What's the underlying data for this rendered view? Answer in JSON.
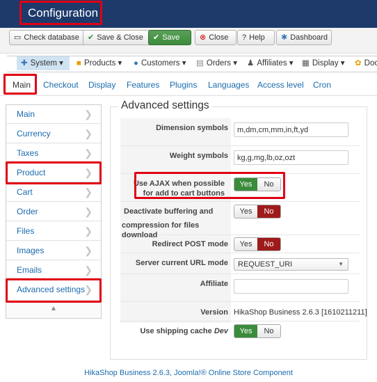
{
  "header": {
    "title": "Configuration"
  },
  "toolbar": {
    "check_database": "Check database",
    "save_close": "Save & Close",
    "save": "Save",
    "close": "Close",
    "help": "Help",
    "dashboard": "Dashboard"
  },
  "menu": {
    "system": "System",
    "products": "Products",
    "customers": "Customers",
    "orders": "Orders",
    "affiliates": "Affiliates",
    "display": "Display",
    "documentation": "Doc"
  },
  "tabs": [
    "Main",
    "Checkout",
    "Display",
    "Features",
    "Plugins",
    "Languages",
    "Access level",
    "Cron"
  ],
  "sidebar": {
    "items": [
      "Main",
      "Currency",
      "Taxes",
      "Product",
      "Cart",
      "Order",
      "Files",
      "Images",
      "Emails",
      "Advanced settings"
    ]
  },
  "section": {
    "title": "Advanced settings"
  },
  "settings": {
    "dimension_label": "Dimension symbols",
    "dimension_value": "m,dm,cm,mm,in,ft,yd",
    "weight_label": "Weight symbols",
    "weight_value": "kg,g,mg,lb,oz,ozt",
    "ajax_label_1": "Use AJAX when possible",
    "ajax_label_2": "for add to cart buttons",
    "buffer_label_1": "Deactivate buffering and",
    "buffer_label_2": "compression for files download",
    "redirect_label": "Redirect POST mode",
    "url_mode_label": "Server current URL mode",
    "url_mode_value": "REQUEST_URI",
    "affiliate_label": "Affiliate",
    "affiliate_value": "",
    "version_label": "Version",
    "version_value": "HikaShop Business 2.6.3 [1610211211]",
    "shipping_cache_label": "Use shipping cache",
    "shipping_cache_suffix": "Dev",
    "yes": "Yes",
    "no": "No"
  },
  "footer": {
    "text": "HikaShop Business 2.6.3, Joomla!® Online Store Component"
  },
  "colors": {
    "header_bg": "#1d3a6b",
    "highlight": "#e00014",
    "yes_active": "#3a8b3a",
    "no_active": "#9e1b1b",
    "link": "#1a6bad"
  }
}
